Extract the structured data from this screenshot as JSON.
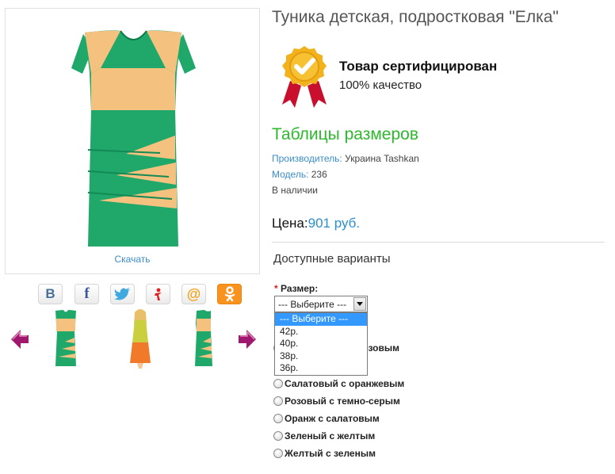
{
  "product": {
    "title": "Туника детская, подростковая \"Елка\"",
    "download_label": "Скачать"
  },
  "certificate": {
    "title": "Товар сертифицирован",
    "subtitle": "100% качество"
  },
  "size_table_link": "Таблицы размеров",
  "meta": {
    "manufacturer_key": "Производитель:",
    "manufacturer_value": "Украина Tashkan",
    "model_key": "Модель:",
    "model_value": "236",
    "availability": "В наличии"
  },
  "price": {
    "label": "Цена:",
    "value": "901 руб."
  },
  "variants": {
    "heading": "Доступные варианты",
    "size_label": "Размер:",
    "required_mark": "*",
    "size_select_value": "--- Выберите ---",
    "size_options": [
      "--- Выберите ---",
      "42р.",
      "40р.",
      "38р.",
      "36р."
    ],
    "hidden_option_fragment": "озовым",
    "color_options": [
      "Салатовый с оранжевым",
      "Розовый с темно-серым",
      "Оранж с салатовым",
      "Зеленый с желтым",
      "Желтый с зеленым"
    ]
  },
  "share": {
    "vk": "В",
    "facebook": "f",
    "twitter_icon": "twitter-bird-icon",
    "yaru_icon": "ya-ru-icon",
    "mail": "@",
    "odnoklassniki_icon": "odnoklassniki-icon"
  },
  "colors": {
    "dress_green": "#1fa86a",
    "dress_peach": "#f4c27e",
    "link_blue": "#3a8dc8",
    "price_blue": "#2a8fd0",
    "size_link_green": "#2db82d",
    "badge_gold": "#f2b21c",
    "badge_red": "#c8102e",
    "arrow_purple": "#a0186e"
  }
}
